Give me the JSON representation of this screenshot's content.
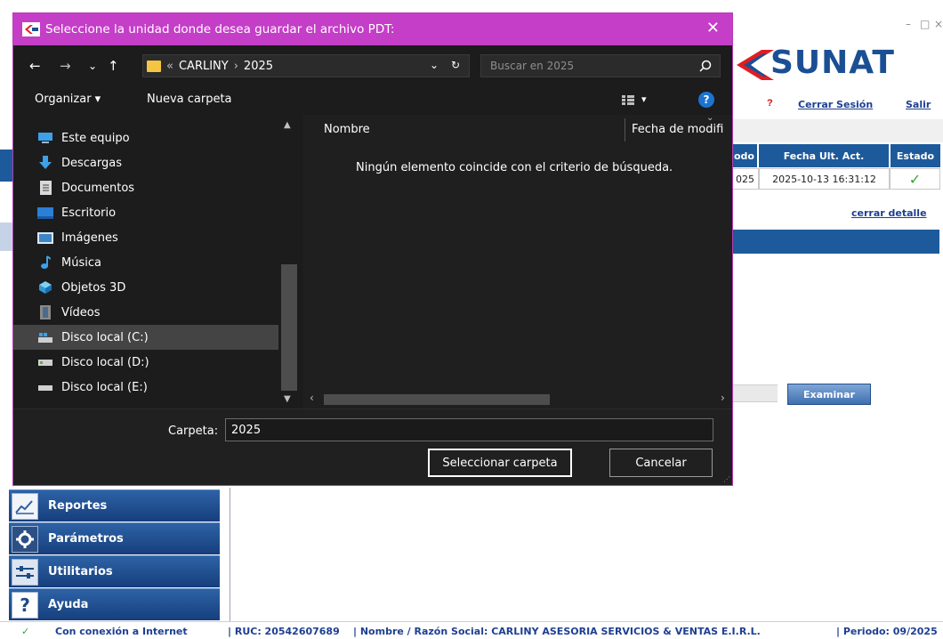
{
  "dialog": {
    "title": "Seleccione la unidad donde desea guardar el archivo PDT:",
    "close_glyph": "✕",
    "nav": {
      "back": "←",
      "forward": "→",
      "recent": "⌄",
      "up": "↑"
    },
    "address": {
      "overflow": "«",
      "crumbs": [
        "CARLINY",
        "2025"
      ],
      "separator": "›",
      "dropdown": "⌄",
      "refresh": "↻"
    },
    "search": {
      "placeholder": "Buscar en 2025"
    },
    "toolbar": {
      "organize": "Organizar ▾",
      "new_folder": "Nueva carpeta",
      "view_dropdown": "▾",
      "help": "?"
    },
    "tree": [
      {
        "label": "Este equipo",
        "icon": "computer-icon",
        "selected": false
      },
      {
        "label": "Descargas",
        "icon": "download-icon",
        "selected": false
      },
      {
        "label": "Documentos",
        "icon": "document-icon",
        "selected": false
      },
      {
        "label": "Escritorio",
        "icon": "desktop-icon",
        "selected": false
      },
      {
        "label": "Imágenes",
        "icon": "pictures-icon",
        "selected": false
      },
      {
        "label": "Música",
        "icon": "music-icon",
        "selected": false
      },
      {
        "label": "Objetos 3D",
        "icon": "objects-3d-icon",
        "selected": false
      },
      {
        "label": "Vídeos",
        "icon": "videos-icon",
        "selected": false
      },
      {
        "label": "Disco local (C:)",
        "icon": "drive-c-icon",
        "selected": true
      },
      {
        "label": "Disco local (D:)",
        "icon": "drive-icon",
        "selected": false
      },
      {
        "label": "Disco local (E:)",
        "icon": "drive-icon",
        "selected": false
      }
    ],
    "columns": {
      "name": "Nombre",
      "date": "Fecha de modifi"
    },
    "empty_message": "Ningún elemento coincide con el criterio de búsqueda.",
    "folder_label": "Carpeta:",
    "folder_value": "2025",
    "buttons": {
      "select": "Seleccionar carpeta",
      "cancel": "Cancelar"
    }
  },
  "background": {
    "window_controls": {
      "minimize": "–",
      "maximize": "□",
      "close": "×"
    },
    "logo_text": "SUNAT",
    "links": {
      "help": "?",
      "logout": "Cerrar Sesión",
      "exit": "Salir"
    },
    "table": {
      "headers": [
        "odo",
        "Fecha Ult. Act.",
        "Estado"
      ],
      "row": [
        "025",
        "2025-10-13 16:31:12",
        "✓"
      ]
    },
    "close_detail": "cerrar detalle",
    "examinar": "Examinar",
    "menu": [
      {
        "label": "Reportes",
        "icon": "reports-chart-icon"
      },
      {
        "label": "Parámetros",
        "icon": "gear-icon"
      },
      {
        "label": "Utilitarios",
        "icon": "tools-icon"
      },
      {
        "label": "Ayuda",
        "icon": "help-icon"
      }
    ],
    "status": {
      "connection": "Con conexión a Internet",
      "ruc": "| RUC: 20542607689",
      "company": "| Nombre / Razón Social: CARLINY ASESORIA SERVICIOS & VENTAS E.I.R.L.",
      "period": "| Periodo: 09/2025"
    }
  },
  "colors": {
    "dialog_title": "#c43ec7",
    "dialog_bg": "#202020",
    "sunat_blue": "#1d5a9c",
    "link_blue": "#1e3f92"
  }
}
